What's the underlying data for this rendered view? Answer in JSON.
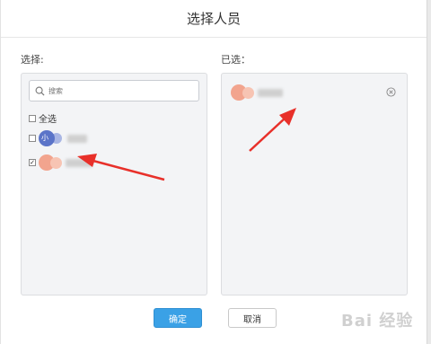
{
  "dialog": {
    "title": "选择人员",
    "left_label": "选择:",
    "right_label": "已选：",
    "search": {
      "placeholder": "搜索"
    },
    "select_all_label": "全选",
    "candidates": [
      {
        "name_partial": "小",
        "checked": false,
        "avatar_color": "#5b74c8"
      },
      {
        "name_partial": "",
        "checked": true,
        "avatar_color": "#f2a48e"
      }
    ],
    "selected": [
      {
        "name_partial": "",
        "avatar_color": "#f2a48e",
        "remove_icon": "close-circle-icon"
      }
    ],
    "confirm_label": "确定",
    "cancel_label": "取消"
  },
  "annotations": {
    "arrow_color": "#e8302a"
  },
  "watermark": {
    "text": "Bai 经验"
  },
  "colors": {
    "accent": "#3aa1e6",
    "panel_bg": "#f3f4f6"
  }
}
